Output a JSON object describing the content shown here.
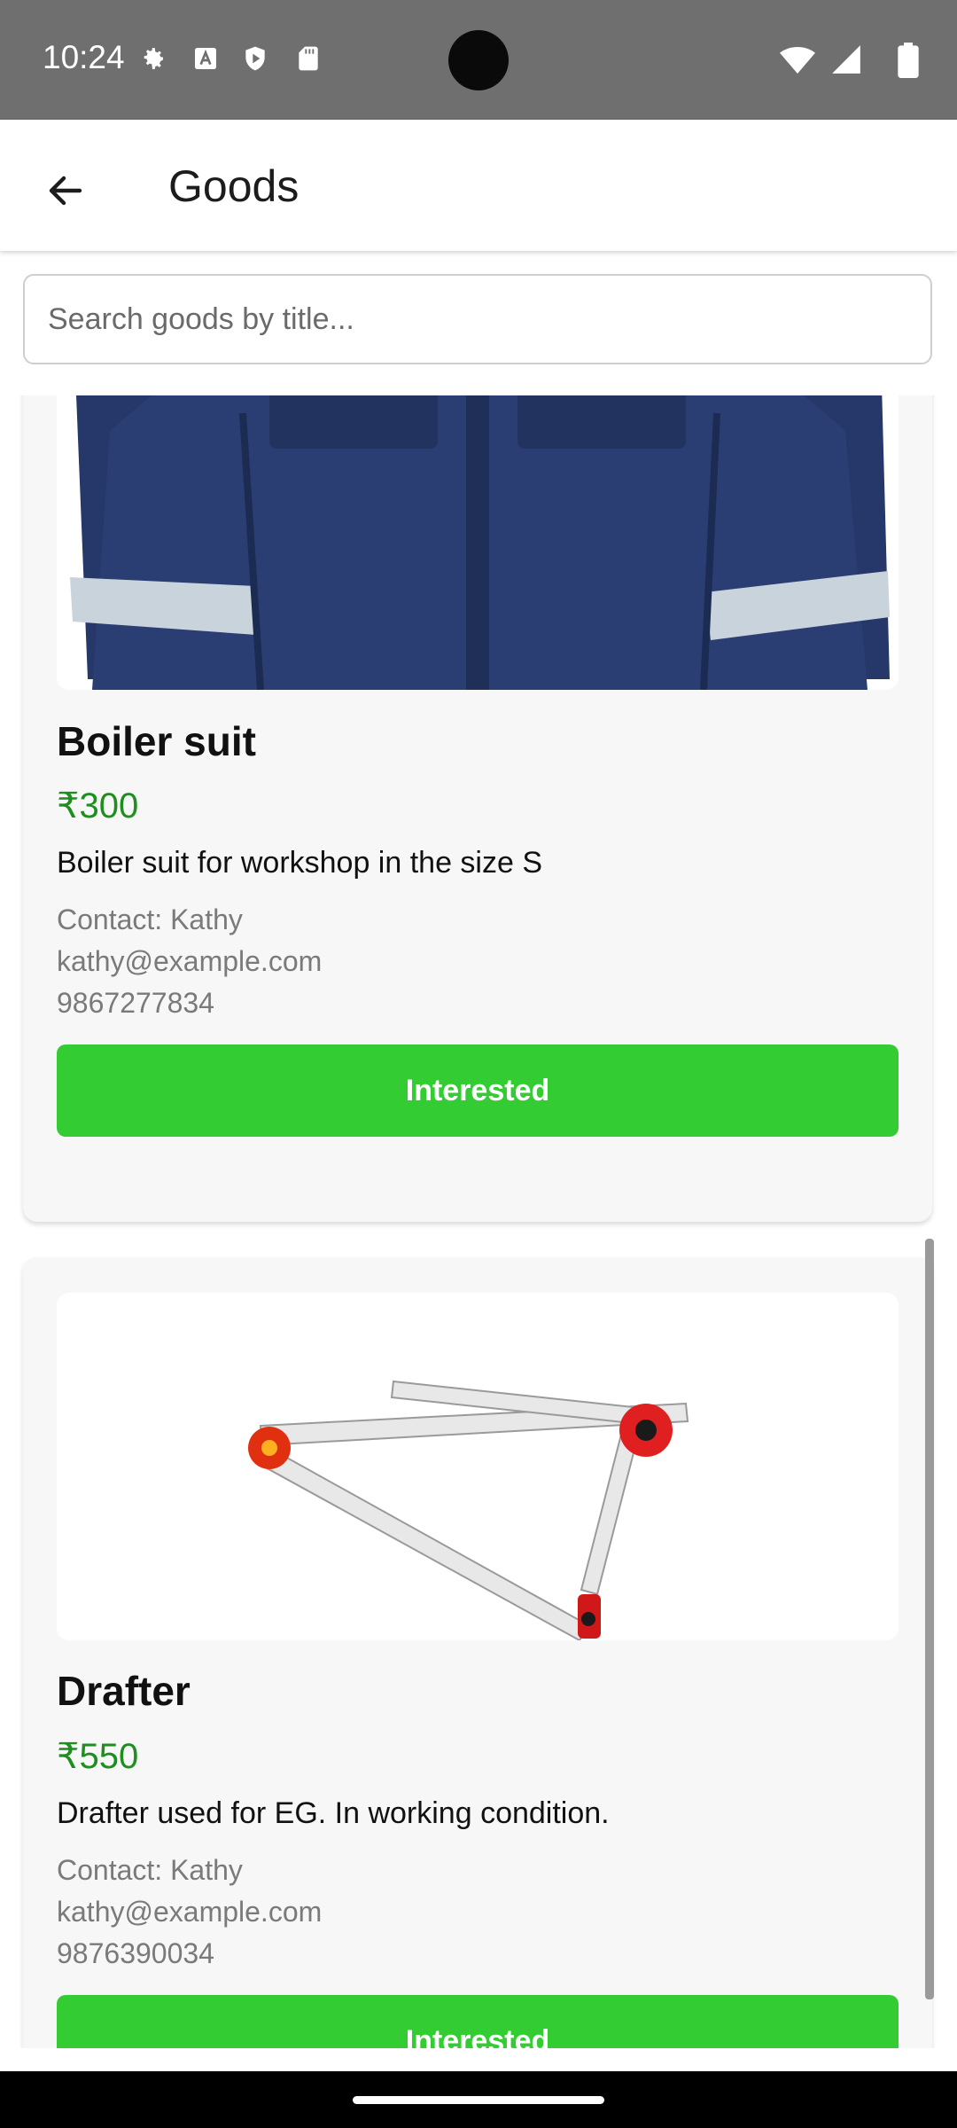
{
  "status_bar": {
    "time": "10:24",
    "left_icons": [
      "gear-icon",
      "font-a-icon",
      "shield-play-icon",
      "sd-card-icon"
    ],
    "right_icons": [
      "wifi-icon",
      "signal-icon",
      "battery-icon"
    ]
  },
  "app_bar": {
    "back_icon": "arrow-left-icon",
    "title": "Goods"
  },
  "search": {
    "placeholder": "Search goods by title..."
  },
  "items": [
    {
      "image": "navy boiler suit with reflective stripes",
      "title": "Boiler suit",
      "price": "₹300",
      "description": "Boiler suit for workshop in the size S",
      "contact": "Contact: Kathy",
      "email": "kathy@example.com",
      "phone": "9867277834",
      "button": "Interested"
    },
    {
      "image": "drafter drawing instrument",
      "title": "Drafter",
      "price": "₹550",
      "description": "Drafter used for EG. In working condition.",
      "contact": "Contact: Kathy",
      "email": "kathy@example.com",
      "phone": "9876390034",
      "button": "Interested"
    }
  ],
  "colors": {
    "status_bar": "#6f6f6f",
    "price": "#1e8f1e",
    "button": "#33cc33",
    "card_bg": "#f7f7f7"
  }
}
